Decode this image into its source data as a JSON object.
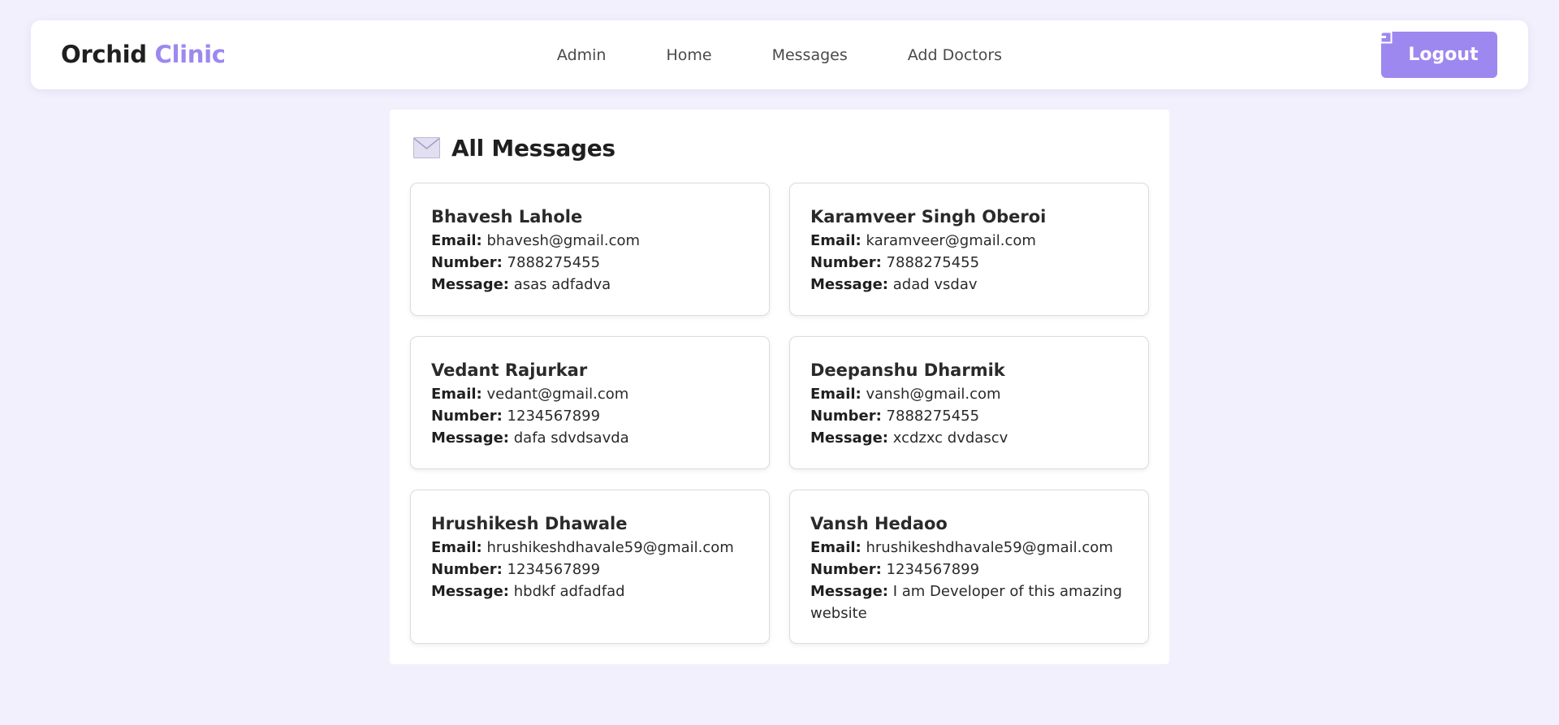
{
  "brand": {
    "first": "Orchid",
    "second": "Clinic"
  },
  "nav": {
    "links": [
      "Admin",
      "Home",
      "Messages",
      "Add Doctors"
    ],
    "logout_label": "Logout",
    "logout_icon": "logout-icon"
  },
  "panel": {
    "icon": "mail-icon",
    "title": "All Messages"
  },
  "labels": {
    "email": "Email:",
    "number": "Number:",
    "message": "Message:"
  },
  "messages": [
    {
      "name": "Bhavesh Lahole",
      "email": "bhavesh@gmail.com",
      "number": "7888275455",
      "message": "asas adfadva"
    },
    {
      "name": "Karamveer Singh Oberoi",
      "email": "karamveer@gmail.com",
      "number": "7888275455",
      "message": "adad vsdav"
    },
    {
      "name": "Vedant Rajurkar",
      "email": "vedant@gmail.com",
      "number": "1234567899",
      "message": "dafa sdvdsavda"
    },
    {
      "name": "Deepanshu Dharmik",
      "email": "vansh@gmail.com",
      "number": "7888275455",
      "message": "xcdzxc dvdascv"
    },
    {
      "name": "Hrushikesh Dhawale",
      "email": "hrushikeshdhavale59@gmail.com",
      "number": "1234567899",
      "message": "hbdkf adfadfad"
    },
    {
      "name": "Vansh Hedaoo",
      "email": "hrushikeshdhavale59@gmail.com",
      "number": "1234567899",
      "message": "I am Developer of this amazing website"
    }
  ],
  "colors": {
    "background": "#f2f0fd",
    "accent": "#9d88f0",
    "card_border": "#dcdcdc"
  }
}
